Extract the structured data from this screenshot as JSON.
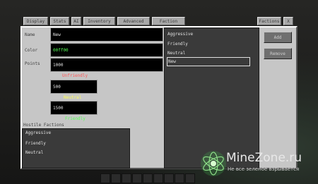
{
  "tabs": [
    "Display",
    "Stats",
    "AI",
    "Inventory",
    "Advanced",
    "Faction",
    "Factions",
    "X"
  ],
  "fields": {
    "name_label": "Name",
    "name_value": "New",
    "color_label": "Color",
    "color_value": "00ff00",
    "points_label": "Points",
    "points_value": "1000"
  },
  "thresholds": {
    "unfriendly_label": "Unfriendly",
    "unfriendly_value": "500",
    "neutral_label": "Neutral",
    "neutral_value": "1500",
    "friendly_label": "Friendly"
  },
  "hostile": {
    "label": "Hostile Factions",
    "items": [
      "Aggressive",
      "Friendly",
      "Neutral"
    ]
  },
  "faction_list": {
    "items": [
      "Aggressive",
      "Friendly",
      "Neutral",
      "New"
    ],
    "selected": "New"
  },
  "buttons": {
    "add": "Add",
    "remove": "Remove"
  },
  "watermark": {
    "title": "MineZone.ru",
    "subtitle": "Не все зеленое взрывается"
  },
  "colors": {
    "panel": "#c6c6c6",
    "field_bg": "#000000",
    "color_value": "#55ff55",
    "unfriendly": "#ff5555",
    "neutral": "#ffff55",
    "friendly": "#55ff55"
  }
}
